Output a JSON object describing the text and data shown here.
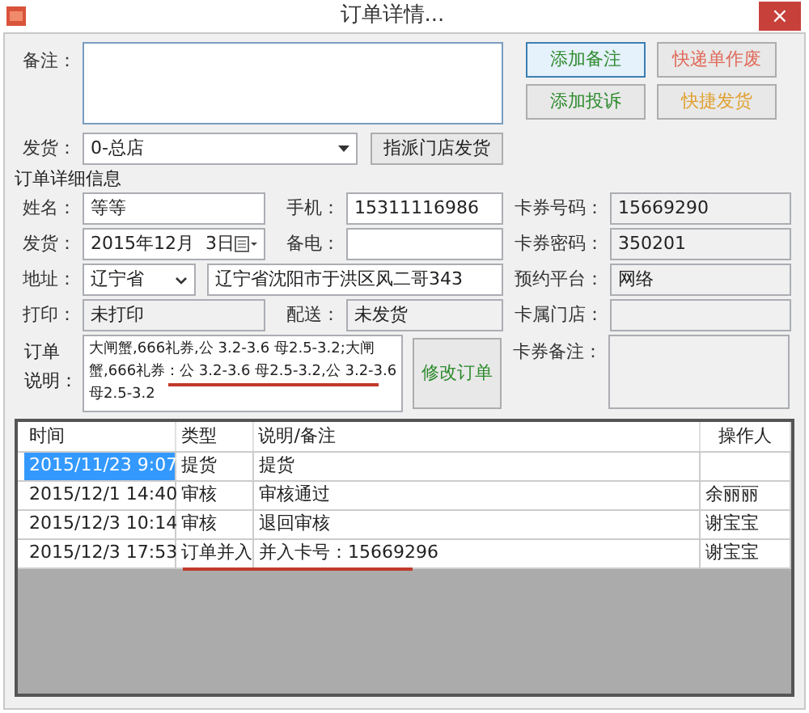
{
  "window": {
    "title": "订单详情...",
    "close": "×"
  },
  "remark": {
    "label": "备注："
  },
  "buttons": [
    {
      "label": "添加备注",
      "color": "#2e8b2e",
      "focused": true
    },
    {
      "label": "快递单作废",
      "color": "#e06a5a",
      "focused": false
    },
    {
      "label": "添加投诉",
      "color": "#2e8b2e",
      "focused": false
    },
    {
      "label": "快捷发货",
      "color": "#e0a030",
      "focused": false
    }
  ],
  "ship": {
    "label": "发货：",
    "value": "0-总店",
    "button": "指派门店发货"
  },
  "section_title": "订单详细信息",
  "fields": {
    "name": {
      "label": "姓名：",
      "value": "等等"
    },
    "phone": {
      "label": "手机：",
      "value": "15311116986"
    },
    "card_no": {
      "label": "卡券号码：",
      "value": "15669290"
    },
    "ship_date": {
      "label": "发货：",
      "value": "2015年12月  3日"
    },
    "backup_phone": {
      "label": "备电："
    },
    "card_pwd": {
      "label": "卡券密码：",
      "value": "350201"
    },
    "address": {
      "label": "地址：",
      "province": "辽宁省",
      "value": "辽宁省沈阳市于洪区风二哥343"
    },
    "platform": {
      "label": "预约平台：",
      "value": "网络"
    },
    "print": {
      "label": "打印：",
      "value": "未打印"
    },
    "delivery": {
      "label": "配送：",
      "value": "未发货"
    },
    "card_store": {
      "label": "卡属门店："
    },
    "order_desc": {
      "label_lines": [
        "订单",
        "说明："
      ],
      "lines": [
        "大闸蟹,666礼券,公 3.2-3.6 母2.5-3.2;大闸",
        "蟹,666礼券：公 3.2-3.6 母2.5-3.2,公 3.2-3.6",
        "母2.5-3.2"
      ],
      "marked": true
    },
    "card_note": {
      "label": "卡券备注："
    }
  },
  "edit_button": "修改订单",
  "table": {
    "columns": [
      "时间",
      "类型",
      "说明/备注",
      "操作人"
    ],
    "rows": [
      {
        "cells": [
          "2015/11/23 9:07",
          "提货",
          "提货",
          ""
        ],
        "selected": true,
        "marked": false
      },
      {
        "cells": [
          "2015/12/1 14:40",
          "审核",
          "审核通过",
          "余丽丽"
        ],
        "selected": false,
        "marked": false
      },
      {
        "cells": [
          "2015/12/3 10:14",
          "审核",
          "退回审核",
          "谢宝宝"
        ],
        "selected": false,
        "marked": false
      },
      {
        "cells": [
          "2015/12/3 17:53",
          "订单并入",
          "并入卡号：15669296",
          "谢宝宝"
        ],
        "selected": false,
        "marked": true
      }
    ]
  }
}
